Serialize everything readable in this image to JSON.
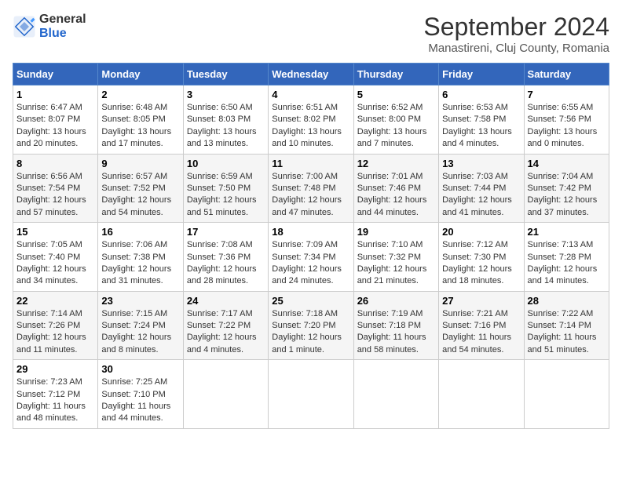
{
  "logo": {
    "general": "General",
    "blue": "Blue"
  },
  "title": "September 2024",
  "subtitle": "Manastireni, Cluj County, Romania",
  "days_of_week": [
    "Sunday",
    "Monday",
    "Tuesday",
    "Wednesday",
    "Thursday",
    "Friday",
    "Saturday"
  ],
  "weeks": [
    [
      {
        "day": 1,
        "sunrise": "6:47 AM",
        "sunset": "8:07 PM",
        "daylight": "13 hours and 20 minutes."
      },
      {
        "day": 2,
        "sunrise": "6:48 AM",
        "sunset": "8:05 PM",
        "daylight": "13 hours and 17 minutes."
      },
      {
        "day": 3,
        "sunrise": "6:50 AM",
        "sunset": "8:03 PM",
        "daylight": "13 hours and 13 minutes."
      },
      {
        "day": 4,
        "sunrise": "6:51 AM",
        "sunset": "8:02 PM",
        "daylight": "13 hours and 10 minutes."
      },
      {
        "day": 5,
        "sunrise": "6:52 AM",
        "sunset": "8:00 PM",
        "daylight": "13 hours and 7 minutes."
      },
      {
        "day": 6,
        "sunrise": "6:53 AM",
        "sunset": "7:58 PM",
        "daylight": "13 hours and 4 minutes."
      },
      {
        "day": 7,
        "sunrise": "6:55 AM",
        "sunset": "7:56 PM",
        "daylight": "13 hours and 0 minutes."
      }
    ],
    [
      {
        "day": 8,
        "sunrise": "6:56 AM",
        "sunset": "7:54 PM",
        "daylight": "12 hours and 57 minutes."
      },
      {
        "day": 9,
        "sunrise": "6:57 AM",
        "sunset": "7:52 PM",
        "daylight": "12 hours and 54 minutes."
      },
      {
        "day": 10,
        "sunrise": "6:59 AM",
        "sunset": "7:50 PM",
        "daylight": "12 hours and 51 minutes."
      },
      {
        "day": 11,
        "sunrise": "7:00 AM",
        "sunset": "7:48 PM",
        "daylight": "12 hours and 47 minutes."
      },
      {
        "day": 12,
        "sunrise": "7:01 AM",
        "sunset": "7:46 PM",
        "daylight": "12 hours and 44 minutes."
      },
      {
        "day": 13,
        "sunrise": "7:03 AM",
        "sunset": "7:44 PM",
        "daylight": "12 hours and 41 minutes."
      },
      {
        "day": 14,
        "sunrise": "7:04 AM",
        "sunset": "7:42 PM",
        "daylight": "12 hours and 37 minutes."
      }
    ],
    [
      {
        "day": 15,
        "sunrise": "7:05 AM",
        "sunset": "7:40 PM",
        "daylight": "12 hours and 34 minutes."
      },
      {
        "day": 16,
        "sunrise": "7:06 AM",
        "sunset": "7:38 PM",
        "daylight": "12 hours and 31 minutes."
      },
      {
        "day": 17,
        "sunrise": "7:08 AM",
        "sunset": "7:36 PM",
        "daylight": "12 hours and 28 minutes."
      },
      {
        "day": 18,
        "sunrise": "7:09 AM",
        "sunset": "7:34 PM",
        "daylight": "12 hours and 24 minutes."
      },
      {
        "day": 19,
        "sunrise": "7:10 AM",
        "sunset": "7:32 PM",
        "daylight": "12 hours and 21 minutes."
      },
      {
        "day": 20,
        "sunrise": "7:12 AM",
        "sunset": "7:30 PM",
        "daylight": "12 hours and 18 minutes."
      },
      {
        "day": 21,
        "sunrise": "7:13 AM",
        "sunset": "7:28 PM",
        "daylight": "12 hours and 14 minutes."
      }
    ],
    [
      {
        "day": 22,
        "sunrise": "7:14 AM",
        "sunset": "7:26 PM",
        "daylight": "12 hours and 11 minutes."
      },
      {
        "day": 23,
        "sunrise": "7:15 AM",
        "sunset": "7:24 PM",
        "daylight": "12 hours and 8 minutes."
      },
      {
        "day": 24,
        "sunrise": "7:17 AM",
        "sunset": "7:22 PM",
        "daylight": "12 hours and 4 minutes."
      },
      {
        "day": 25,
        "sunrise": "7:18 AM",
        "sunset": "7:20 PM",
        "daylight": "12 hours and 1 minute."
      },
      {
        "day": 26,
        "sunrise": "7:19 AM",
        "sunset": "7:18 PM",
        "daylight": "11 hours and 58 minutes."
      },
      {
        "day": 27,
        "sunrise": "7:21 AM",
        "sunset": "7:16 PM",
        "daylight": "11 hours and 54 minutes."
      },
      {
        "day": 28,
        "sunrise": "7:22 AM",
        "sunset": "7:14 PM",
        "daylight": "11 hours and 51 minutes."
      }
    ],
    [
      {
        "day": 29,
        "sunrise": "7:23 AM",
        "sunset": "7:12 PM",
        "daylight": "11 hours and 48 minutes."
      },
      {
        "day": 30,
        "sunrise": "7:25 AM",
        "sunset": "7:10 PM",
        "daylight": "11 hours and 44 minutes."
      },
      null,
      null,
      null,
      null,
      null
    ]
  ]
}
